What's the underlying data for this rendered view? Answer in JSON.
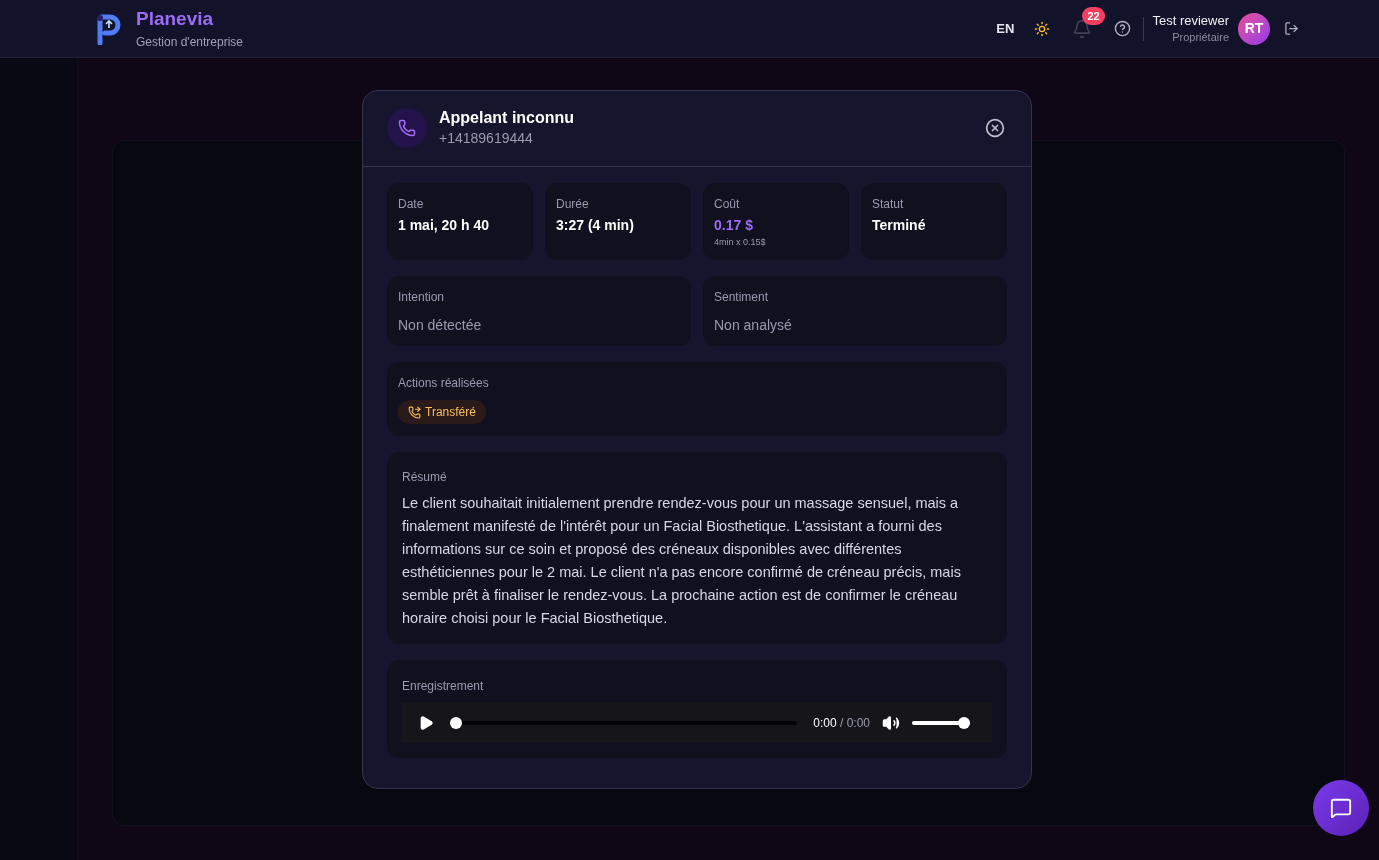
{
  "header": {
    "brand": "Planevia",
    "tagline": "Gestion d'entreprise",
    "language": "EN",
    "notifications": "22",
    "user": {
      "name": "Test reviewer",
      "role": "Propriétaire",
      "initials": "RT"
    }
  },
  "dialog": {
    "title": "Appelant inconnu",
    "phone": "+14189619444",
    "stats": [
      {
        "label": "Date",
        "value": "1 mai, 20 h 40",
        "kind": "plain"
      },
      {
        "label": "Durée",
        "value": "3:27 (4 min)",
        "kind": "plain"
      },
      {
        "label": "Coût",
        "value": "0.17 $",
        "detail": "4min x 0.15$",
        "kind": "cost"
      },
      {
        "label": "Statut",
        "value": "Terminé",
        "kind": "plain"
      }
    ],
    "analysis": [
      {
        "label": "Intention",
        "value": "Non détectée"
      },
      {
        "label": "Sentiment",
        "value": "Non analysé"
      }
    ],
    "actions": {
      "label": "Actions réalisées",
      "tags": [
        "Transféré"
      ]
    },
    "summary": {
      "label": "Résumé",
      "text": "Le client souhaitait initialement prendre rendez-vous pour un massage sensuel, mais a finalement manifesté de l'intérêt pour un Facial Biosthetique. L'assistant a fourni des informations sur ce soin et proposé des créneaux disponibles avec différentes esthéticiennes pour le 2 mai. Le client n'a pas encore confirmé de créneau précis, mais semble prêt à finaliser le rendez-vous. La prochaine action est de confirmer le créneau horaire choisi pour le Facial Biosthetique."
    },
    "recording": {
      "label": "Enregistrement",
      "current": "0:00",
      "separator": "/",
      "total": "0:00",
      "progress": {
        "level": 0
      },
      "volume": {
        "level": 1
      }
    }
  }
}
